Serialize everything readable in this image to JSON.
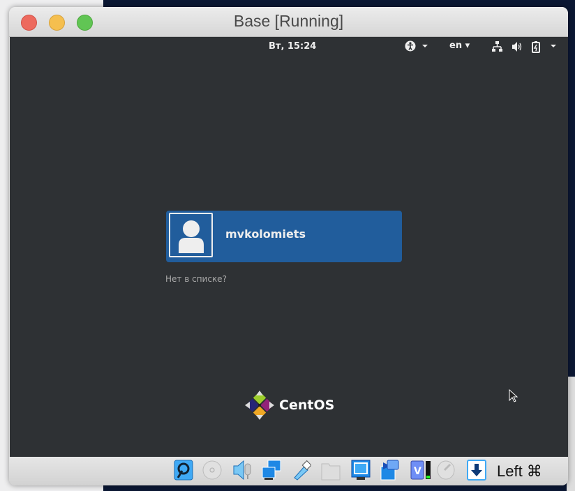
{
  "window": {
    "title": "Base [Running]"
  },
  "topbar": {
    "clock": "Вт, 15:24",
    "language": "en",
    "icons": [
      "accessibility-icon",
      "network-icon",
      "volume-icon",
      "battery-icon"
    ]
  },
  "login": {
    "username": "mvkolomiets",
    "not_listed": "Нет в списке?"
  },
  "branding": {
    "logo_text": "CentOS"
  },
  "statusbar": {
    "host_key": "Left ⌘",
    "icons": [
      "hard-disk-icon",
      "optical-drive-icon",
      "audio-icon",
      "network-icon",
      "usb-icon",
      "shared-folders-icon",
      "display-icon",
      "video-capture-icon",
      "cpu-icon",
      "mouse-integration-icon",
      "keyboard-capture-icon"
    ]
  },
  "colors": {
    "selection": "#215d9c",
    "screen_bg": "#2e3134"
  }
}
